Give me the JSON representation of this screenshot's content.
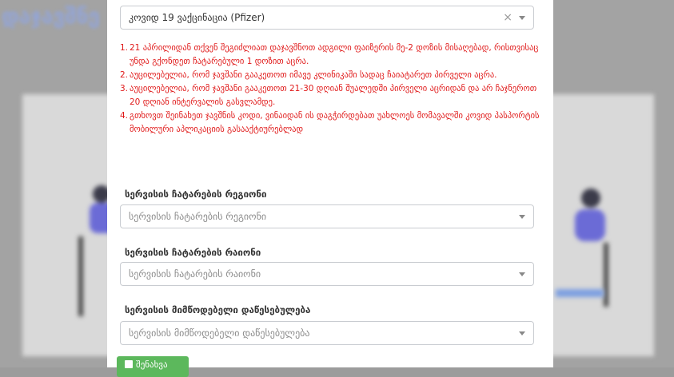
{
  "vaccine_select": {
    "value": "კოვიდ 19 ვაქცინაცია (Pfizer)",
    "clear_symbol": "×"
  },
  "notes": [
    {
      "num": "1.",
      "text": "21 აპრილიდან თქვენ შეგიძლიათ დაჯავშნოთ ადგილი ფაიზერის მე-2 დოზის მისაღებად, რისთვისაც უნდა გქონდეთ ჩატარებული 1 დოზით აცრა."
    },
    {
      "num": "2.",
      "text": "აუცილებელია, რომ ჯავშანი გააკეთოთ იმავე კლინიკაში სადაც ჩაიატარეთ პირველი აცრა."
    },
    {
      "num": "3.",
      "text": "აუცილებელია, რომ ჯავშანი გააკეთოთ 21-30 დღიან შუალედში პირველი აცრიდან და არ ჩაჯნეროთ 20 დღიან ინტერვალის გასვლამდე."
    },
    {
      "num": "4.",
      "text": "გთხოვთ შეინახეთ ჯავშნის კოდი, ვინაიდან ის დაგჭირდებათ უახლოეს მომავალში კოვიდ პასპორტის მობილური აპლიკაციის გასააქტიურებლად"
    }
  ],
  "region": {
    "label": "სერვისის ჩატარების რეგიონი",
    "placeholder": "სერვისის ჩატარების რეგიონი"
  },
  "district": {
    "label": "სერვისის ჩატარების რაიონი",
    "placeholder": "სერვისის ჩატარების რაიონი"
  },
  "provider": {
    "label": "სერვისის მიმწოდებელი დაწესებულება",
    "placeholder": "სერვისის მიმწოდებელი დაწესებულება"
  },
  "save_button": {
    "label": "შენახვა"
  },
  "background": {
    "title": "დაჯავშნე"
  }
}
